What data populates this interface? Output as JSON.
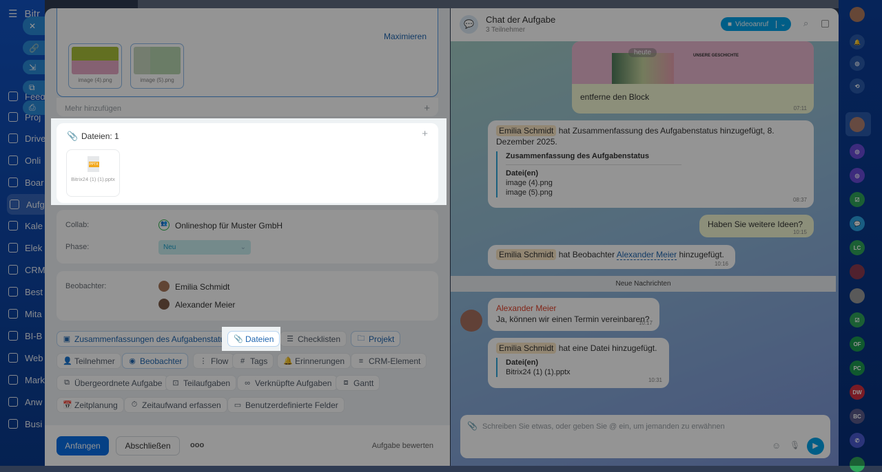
{
  "left_nav": {
    "title": "Bitr",
    "items": [
      "Feed",
      "Proj",
      "Drive",
      "Onli",
      "Boar",
      "Aufg",
      "Kale",
      "Elek",
      "CRM",
      "Best",
      "Mita",
      "BI-B",
      "Web",
      "Mark",
      "Anw",
      "Busi"
    ]
  },
  "task": {
    "maximize": "Maximieren",
    "images": [
      "image (4).png",
      "image (5).png"
    ],
    "add_more": "Mehr hinzufügen",
    "files": {
      "title": "Dateien: 1",
      "file_ext": "PPTX",
      "file_name": "Bitrix24 (1) (1).pptx"
    },
    "collab_label": "Collab:",
    "collab_value": "Onlineshop für Muster GmbH",
    "phase_label": "Phase:",
    "phase_value": "Neu",
    "observers_label": "Beobachter:",
    "observers": [
      "Emilia Schmidt",
      "Alexander Meier"
    ],
    "chips": [
      "Zusammenfassungen des Aufgabenstatus",
      "Dateien",
      "Checklisten",
      "Projekt",
      "Teilnehmer",
      "Beobachter",
      "Flow",
      "Tags",
      "Erinnerungen",
      "CRM-Element",
      "Übergeordnete Aufgabe",
      "Teilaufgaben",
      "Verknüpfte Aufgaben",
      "Gantt",
      "Zeitplanung",
      "Zeitaufwand erfassen",
      "Benutzerdefinierte Felder"
    ],
    "footer": {
      "start": "Anfangen",
      "complete": "Abschließen",
      "more": "ooo",
      "rate": "Aufgabe bewerten"
    }
  },
  "chat": {
    "title": "Chat der Aufgabe",
    "subtitle": "3 Teilnehmer",
    "video": "Videoanruf",
    "day": "heute",
    "preview_heading": "UNSERE GESCHICHTE",
    "msg1": {
      "text": "entferne den Block",
      "time": "07:11"
    },
    "msg2": {
      "author": "Emilia Schmidt",
      "text": "hat Zusammenfassung des Aufgabenstatus hinzugefügt, 8. Dezember 2025.",
      "quote_title": "Zusammenfassung des Aufgabenstatus",
      "files_label": "Datei(en)",
      "files": [
        "image (4).png",
        "image (5).png"
      ],
      "time": "08:37"
    },
    "msg3": {
      "text": "Haben Sie weitere Ideen?",
      "time": "10:15"
    },
    "msg4": {
      "author": "Emilia Schmidt",
      "pre": "hat Beobachter",
      "link": "Alexander Meier",
      "post": "hinzugefügt.",
      "time": "10:16"
    },
    "new_messages": "Neue Nachrichten",
    "msg5": {
      "author": "Alexander Meier",
      "text": "Ja, können wir einen Termin vereinbaren?",
      "time": "10:17"
    },
    "msg6": {
      "author": "Emilia Schmidt",
      "text": "hat eine Datei hinzugefügt.",
      "files_label": "Datei(en)",
      "file": "Bitrix24 (1) (1).pptx",
      "time": "10:31"
    },
    "input_placeholder": "Schreiben Sie etwas, oder geben Sie @ ein, um jemanden zu erwähnen"
  },
  "right_bar": {
    "initials": [
      "LC",
      "OF",
      "PC",
      "DW",
      "BC"
    ]
  },
  "colors": {
    "accent": "#2066b0",
    "video": "#00a2e8",
    "author_red": "#e0402a"
  }
}
